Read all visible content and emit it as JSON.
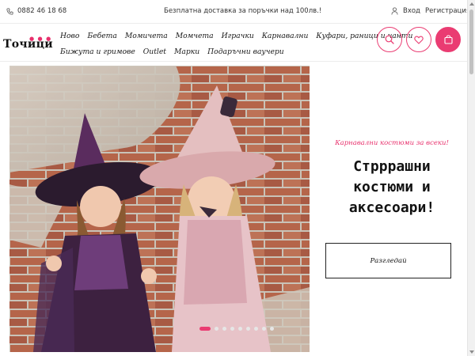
{
  "topbar": {
    "phone": "0882 46 18 68",
    "promo": "Безплатна доставка за поръчки над 100лв.!",
    "login": "Вход",
    "register": "Регистрация"
  },
  "header": {
    "logo": "Точици",
    "nav_row1": [
      "Ново",
      "Бебета",
      "Момичета",
      "Момчета",
      "Играчки",
      "Карнавални",
      "Куфари, раници и чанти"
    ],
    "nav_row2": [
      "Бижута и гримове",
      "Outlet",
      "Марки",
      "Подаръчни ваучери"
    ],
    "icons": [
      "search-icon",
      "heart-icon",
      "shopping-bag-icon"
    ]
  },
  "hero": {
    "eyebrow": "Карнавални костюми за всеки!",
    "headline": "Стрррашни костюми и аксесоари!",
    "button": "Разгледай",
    "slides_total": 9,
    "active_slide": 1
  },
  "colors": {
    "accent": "#ea3c72",
    "text": "#111111"
  }
}
